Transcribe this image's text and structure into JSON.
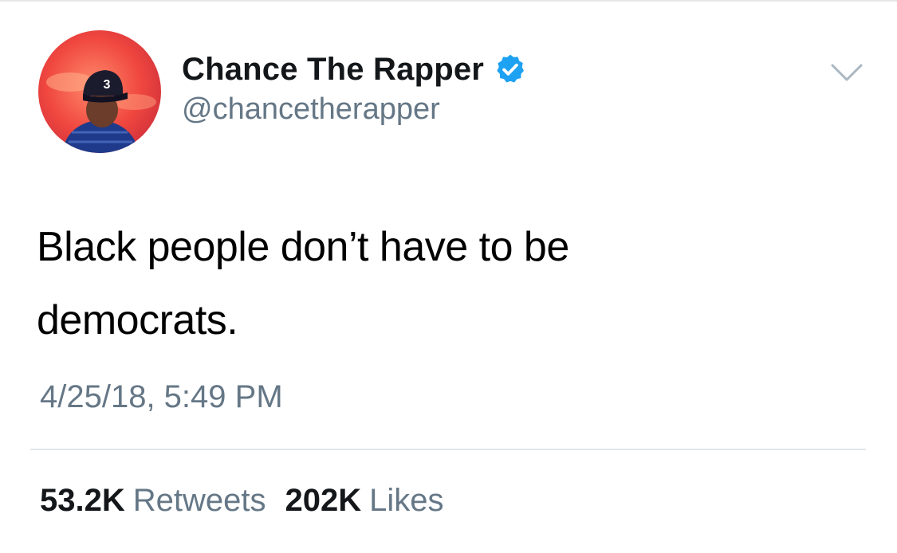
{
  "tweet": {
    "author": {
      "display_name": "Chance The Rapper",
      "handle": "@chancetherapper",
      "verified": true,
      "avatar_cap_number": "3",
      "avatar_icon": "profile-photo"
    },
    "text_lines": [
      "Black people don’t have to be",
      "democrats."
    ],
    "timestamp": "4/25/18, 5:49 PM",
    "stats": {
      "retweets_count": "53.2K",
      "retweets_label": "Retweets",
      "likes_count": "202K",
      "likes_label": "Likes"
    },
    "menu_icon": "chevron-down-icon"
  },
  "colors": {
    "primary_text": "#14171a",
    "secondary_text": "#657786",
    "verified_blue": "#1da1f2",
    "divider": "#e1e8ed"
  }
}
